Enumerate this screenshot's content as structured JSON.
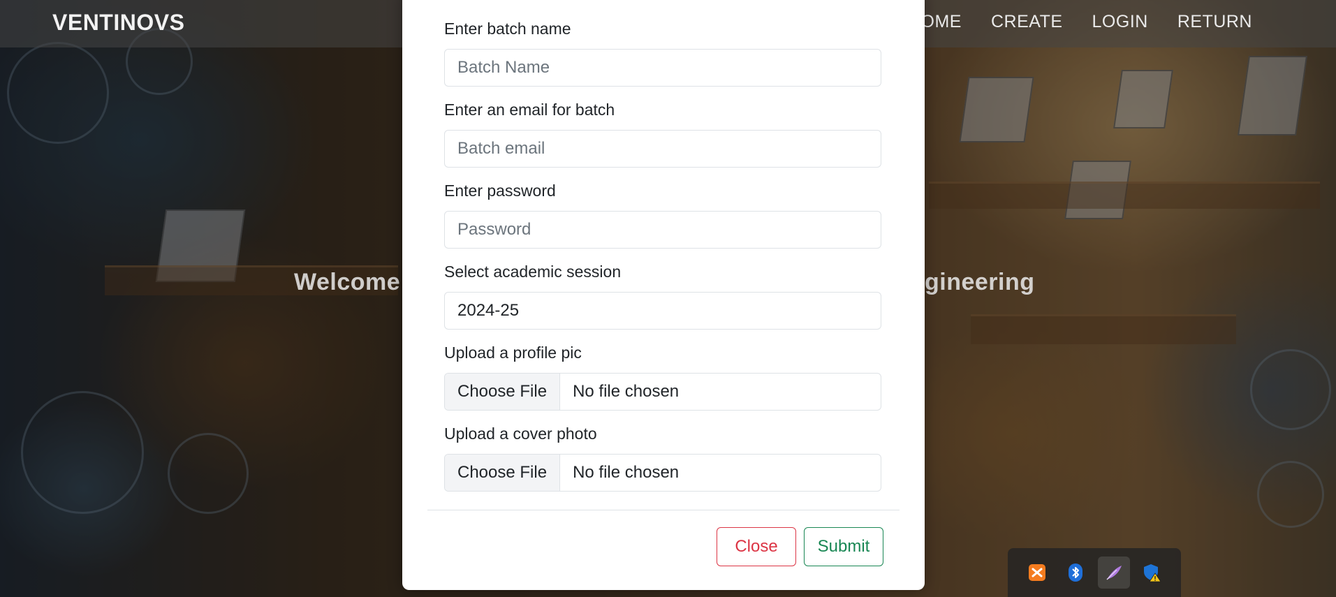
{
  "navbar": {
    "brand": "VENTINOVS",
    "links": [
      "HOME",
      "CREATE",
      "LOGIN",
      "RETURN"
    ]
  },
  "hero": {
    "left_text": "Welcome",
    "right_text": "gineering"
  },
  "modal": {
    "fields": [
      {
        "label": "Enter batch name",
        "placeholder": "Batch Name",
        "value": ""
      },
      {
        "label": "Enter an email for batch",
        "placeholder": "Batch email",
        "value": ""
      },
      {
        "label": "Enter password",
        "placeholder": "Password",
        "value": ""
      },
      {
        "label": "Select academic session",
        "placeholder": "",
        "value": "2024-25"
      }
    ],
    "files": [
      {
        "label": "Upload a profile pic",
        "button": "Choose File",
        "status": "No file chosen"
      },
      {
        "label": "Upload a cover photo",
        "button": "Choose File",
        "status": "No file chosen"
      }
    ],
    "close_label": "Close",
    "submit_label": "Submit"
  },
  "tray": {
    "icons": [
      "xampp-icon",
      "bluetooth-icon",
      "feather-app-icon",
      "security-warning-icon"
    ]
  },
  "colors": {
    "danger": "#dc3545",
    "success": "#198754",
    "navbar_text": "#f2f2f2"
  }
}
